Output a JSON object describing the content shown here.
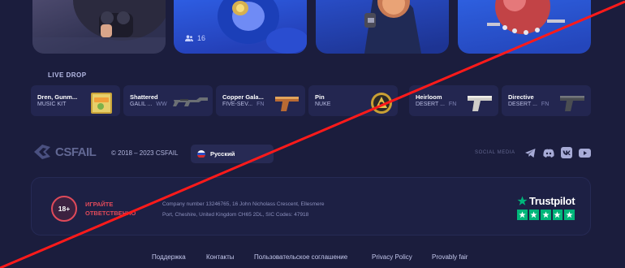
{
  "cases": {
    "users_count": "16"
  },
  "live_drop": {
    "title": "LIVE DROP",
    "items": [
      {
        "name": "Dren, Gunm...",
        "sub": "MUSIC KIT",
        "wear": ""
      },
      {
        "name": "Shattered",
        "sub": "GALIL ...",
        "wear": "WW"
      },
      {
        "name": "Copper Gala...",
        "sub": "FIVE-SEV...",
        "wear": "FN"
      },
      {
        "name": "Pin",
        "sub": "NUKE",
        "wear": ""
      },
      {
        "name": "Heirloom",
        "sub": "DESERT ...",
        "wear": "FN"
      },
      {
        "name": "Directive",
        "sub": "DESERT ...",
        "wear": "FN"
      }
    ]
  },
  "footer": {
    "logo_text": "CSFAIL",
    "copyright": "© 2018 – 2023 CSFAIL",
    "language": "Русский",
    "social_title": "SOCIAL MEDIA",
    "social_icons": [
      "telegram-icon",
      "discord-icon",
      "vk-icon",
      "youtube-icon"
    ]
  },
  "info": {
    "age_badge": "18+",
    "responsible_line1": "ИГРАЙТЕ",
    "responsible_line2": "ОТВЕТСТВЕННО",
    "company_line1": "Company number 13246765, 16 John Nicholass Crescent, Ellesmere",
    "company_line2": "Port, Cheshire, United Kingdom CH65 2DL, SIC Codes: 47918",
    "trustpilot": "Trustpilot",
    "trustpilot_stars": 5
  },
  "bottom_nav": [
    "Поддержка",
    "Контакты",
    "Пользовательское соглашение",
    "Privacy Policy",
    "Provably fair"
  ],
  "colors": {
    "background": "#1b1d3d",
    "card": "#232650",
    "accent_red": "#e04a5a",
    "trustpilot_green": "#00b67a"
  }
}
